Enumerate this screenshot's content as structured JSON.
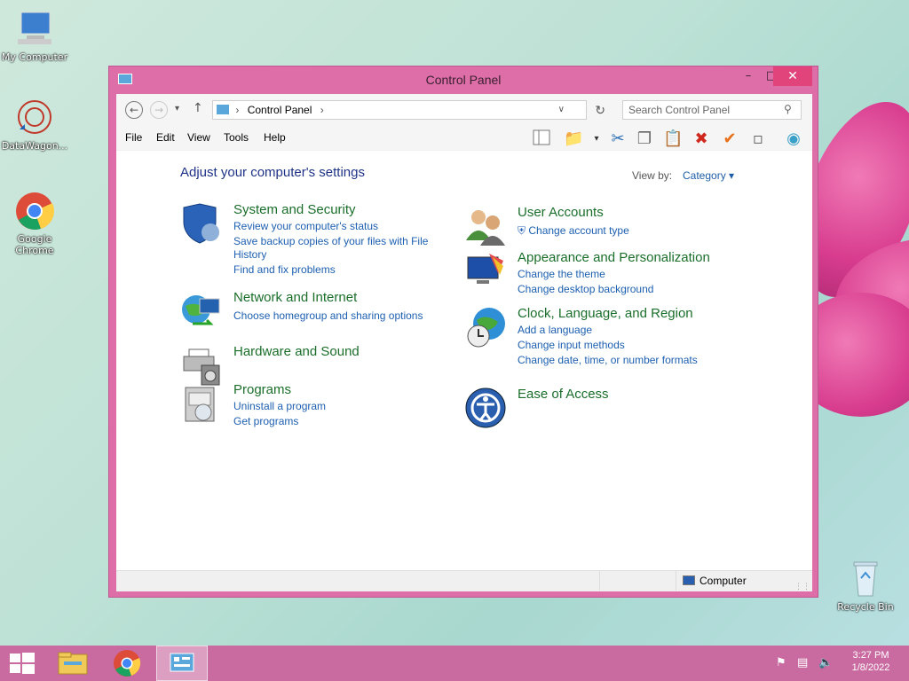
{
  "desktop": {
    "icons": [
      {
        "label": "My Computer"
      },
      {
        "label": "DataWagon..."
      },
      {
        "label": "Google Chrome"
      },
      {
        "label": "Recycle Bin"
      }
    ]
  },
  "window": {
    "title": "Control Panel",
    "buttons": {
      "minimize": "–",
      "maximize": "□",
      "close": "✕"
    },
    "address": {
      "breadcrumb": "Control Panel",
      "sep": "›"
    },
    "search": {
      "placeholder": "Search Control Panel"
    },
    "menu": [
      "File",
      "Edit",
      "View",
      "Tools",
      "Help"
    ],
    "heading": "Adjust your computer's settings",
    "view_by": {
      "label": "View by:",
      "value": "Category ▾"
    },
    "categories_left": [
      {
        "title": "System and Security",
        "links": [
          "Review your computer's status",
          "Save backup copies of your files with File",
          "History",
          "Find and fix problems"
        ]
      },
      {
        "title": "Network and Internet",
        "links": [
          "Choose homegroup and sharing options"
        ]
      },
      {
        "title": "Hardware and Sound",
        "links": []
      },
      {
        "title": "Programs",
        "links": [
          "Uninstall a program",
          "Get programs"
        ]
      }
    ],
    "categories_right": [
      {
        "title": "User Accounts",
        "links": [
          "Change account type"
        ]
      },
      {
        "title": "Appearance and Personalization",
        "links": [
          "Change the theme",
          "Change desktop background"
        ]
      },
      {
        "title": "Clock, Language, and Region",
        "links": [
          "Add a language",
          "Change input methods",
          "Change date, time, or number formats"
        ]
      },
      {
        "title": "Ease of Access",
        "links": []
      }
    ],
    "status": "Computer"
  },
  "taskbar": {
    "clock_time": "3:27 PM",
    "clock_date": "1/8/2022"
  },
  "colors": {
    "accent": "#de6ea8",
    "taskbar": "#c96aa0",
    "title_green": "#1a6e2a",
    "link_blue": "#1d5fb0"
  }
}
